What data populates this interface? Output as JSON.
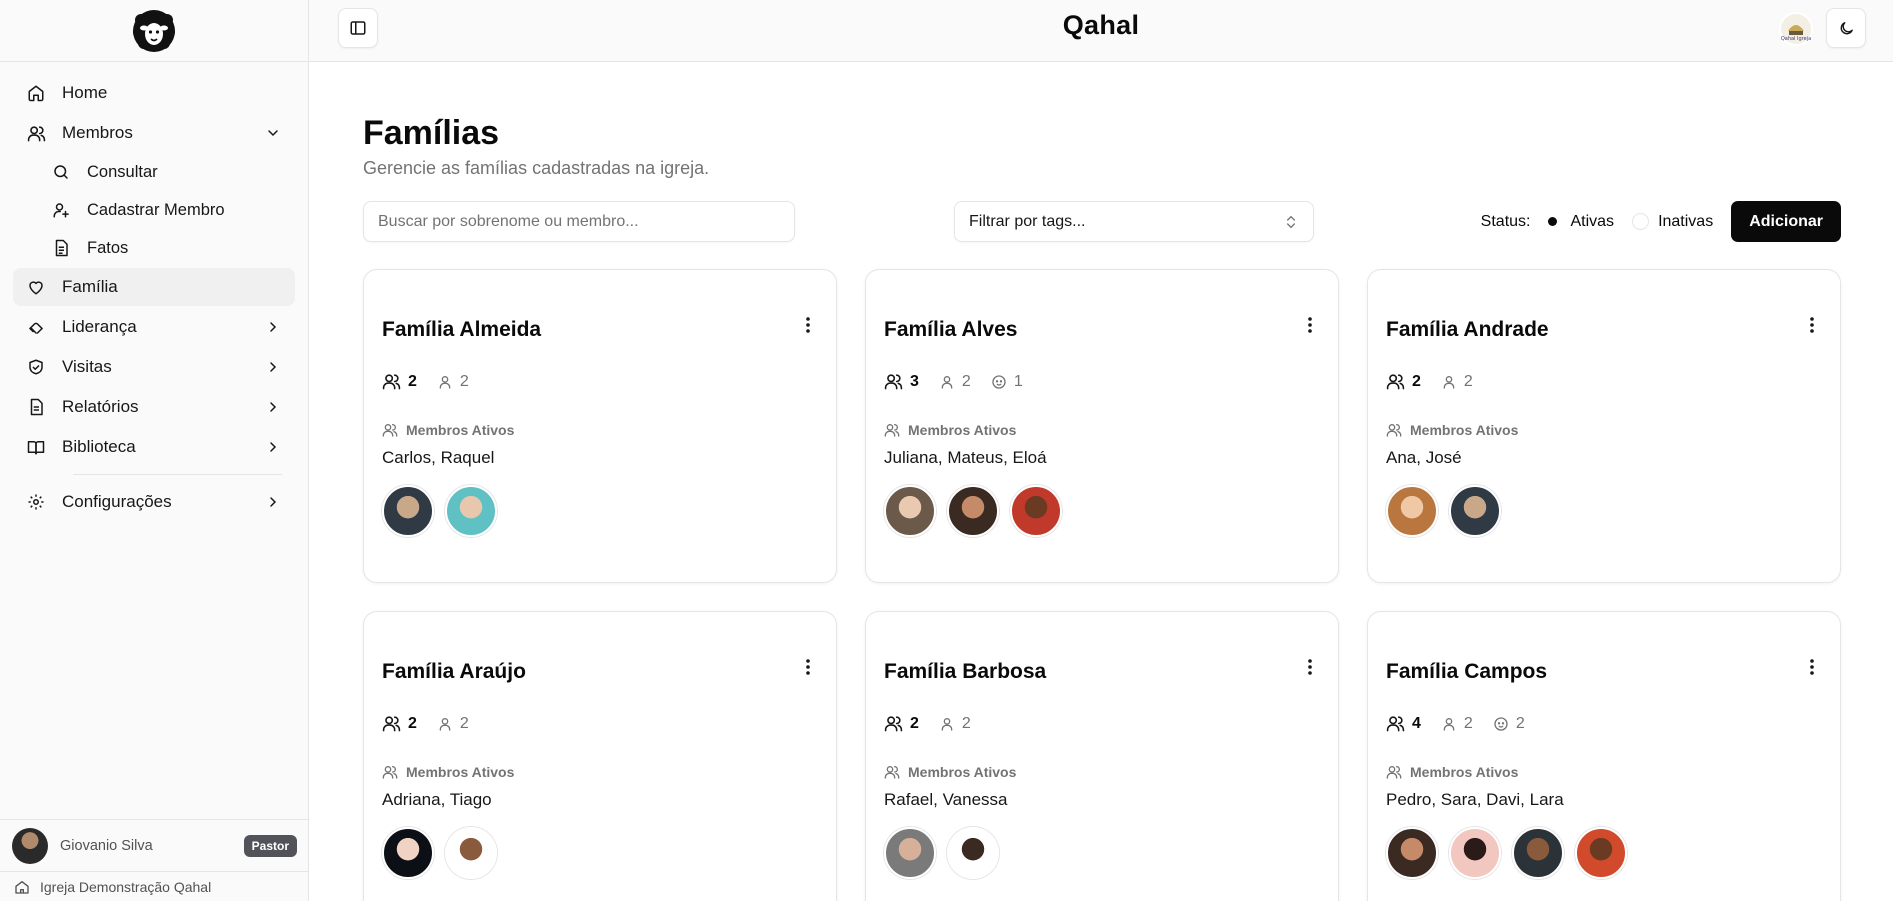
{
  "header": {
    "app_title": "Qahal",
    "sidebar_toggle": "sidebar-toggle-icon",
    "church_logo": "Qahal Igreja",
    "theme_toggle": "moon-icon"
  },
  "sidebar": {
    "logo": "sheep-logo",
    "items": [
      {
        "label": "Home",
        "icon": "home-icon"
      },
      {
        "label": "Membros",
        "icon": "users-icon",
        "expanded": true,
        "children": [
          {
            "label": "Consultar",
            "icon": "search-icon"
          },
          {
            "label": "Cadastrar Membro",
            "icon": "user-plus-icon"
          },
          {
            "label": "Fatos",
            "icon": "file-text-icon"
          }
        ]
      },
      {
        "label": "Família",
        "icon": "heart-icon",
        "active": true
      },
      {
        "label": "Liderança",
        "icon": "handshake-icon"
      },
      {
        "label": "Visitas",
        "icon": "shield-icon"
      },
      {
        "label": "Relatórios",
        "icon": "report-icon"
      },
      {
        "label": "Biblioteca",
        "icon": "book-icon"
      },
      {
        "label": "Configurações",
        "icon": "gear-icon"
      }
    ],
    "user": {
      "name": "Giovanio Silva",
      "role": "Pastor"
    },
    "church": "Igreja Demonstração Qahal"
  },
  "page": {
    "title": "Famílias",
    "subtitle": "Gerencie as famílias cadastradas na igreja.",
    "search_placeholder": "Buscar por sobrenome ou membro...",
    "tag_filter": "Filtrar por tags...",
    "status_label": "Status:",
    "status_options": [
      {
        "label": "Ativas",
        "selected": true
      },
      {
        "label": "Inativas",
        "selected": false
      }
    ],
    "add_label": "Adicionar",
    "members_label": "Membros Ativos"
  },
  "families": [
    {
      "name": "Família Almeida",
      "total": "2",
      "adults": "2",
      "children": null,
      "members": "Carlos, Raquel",
      "avatars": [
        [
          "#2f3a45",
          "#c9a88a"
        ],
        [
          "#5fc1c4",
          "#e8c7ad"
        ]
      ]
    },
    {
      "name": "Família Alves",
      "total": "3",
      "adults": "2",
      "children": "1",
      "members": "Juliana, Mateus, Eloá",
      "avatars": [
        [
          "#6b5a4a",
          "#e9c9b0"
        ],
        [
          "#3a2a22",
          "#c58a68"
        ],
        [
          "#c0392b",
          "#6a3a22"
        ]
      ]
    },
    {
      "name": "Família Andrade",
      "total": "2",
      "adults": "2",
      "children": null,
      "members": "Ana, José",
      "avatars": [
        [
          "#b9773f",
          "#f0c8a6"
        ],
        [
          "#2f3a45",
          "#c9a88a"
        ]
      ]
    },
    {
      "name": "Família Araújo",
      "total": "2",
      "adults": "2",
      "children": null,
      "members": "Adriana, Tiago",
      "avatars": [
        [
          "#0d0f17",
          "#f1d3c3"
        ],
        [
          "#ffffff",
          "#8a5a3c"
        ]
      ]
    },
    {
      "name": "Família Barbosa",
      "total": "2",
      "adults": "2",
      "children": null,
      "members": "Rafael, Vanessa",
      "avatars": [
        [
          "#7a7a7a",
          "#d7b09a"
        ],
        [
          "#ffffff",
          "#3a2a22"
        ]
      ]
    },
    {
      "name": "Família Campos",
      "total": "4",
      "adults": "2",
      "children": "2",
      "members": "Pedro, Sara, Davi, Lara",
      "avatars": [
        [
          "#3a2a22",
          "#c58a68"
        ],
        [
          "#f2c7c0",
          "#2a1a18"
        ],
        [
          "#2b3238",
          "#8a5a3c"
        ],
        [
          "#d04a2b",
          "#6a3a22"
        ]
      ]
    }
  ]
}
